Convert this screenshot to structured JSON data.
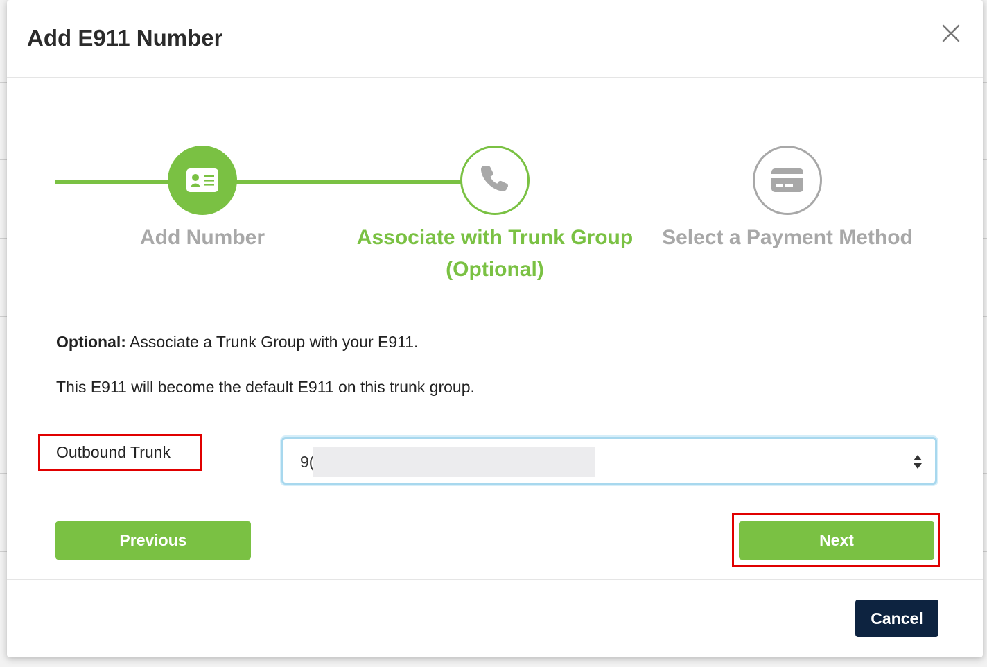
{
  "modal": {
    "title": "Add E911 Number"
  },
  "stepper": {
    "steps": [
      {
        "label": "Add Number",
        "state": "done",
        "icon": "id-card-icon"
      },
      {
        "label": "Associate with Trunk Group (Optional)",
        "state": "active",
        "icon": "phone-icon"
      },
      {
        "label": "Select a Payment Method",
        "state": "todo",
        "icon": "credit-card-icon"
      }
    ]
  },
  "info": {
    "optional_bold": "Optional:",
    "optional_text": " Associate a Trunk Group with your E911.",
    "default_note": "This E911 will become the default E911 on this trunk group."
  },
  "form": {
    "outbound_trunk_label": "Outbound Trunk",
    "outbound_trunk_value": "9("
  },
  "buttons": {
    "previous": "Previous",
    "next": "Next",
    "cancel": "Cancel"
  },
  "colors": {
    "accent_green": "#7ac143",
    "inactive_gray": "#a8a8a8",
    "cancel_navy": "#0d2340",
    "highlight_red": "#e00000"
  }
}
